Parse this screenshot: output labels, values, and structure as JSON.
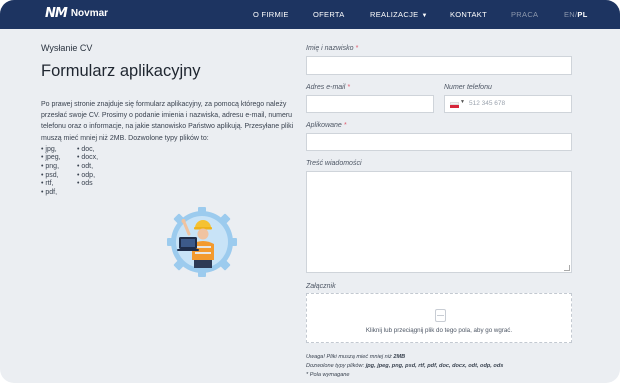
{
  "header": {
    "logo_mark": "NM",
    "logo_text": "Novmar",
    "nav": [
      {
        "label": "O FIRMIE"
      },
      {
        "label": "OFERTA"
      },
      {
        "label": "REALIZACJE"
      },
      {
        "label": "KONTAKT"
      },
      {
        "label": "PRACA"
      }
    ],
    "lang_en": "EN/",
    "lang_pl": "PL"
  },
  "intro": {
    "subtitle": "Wysłanie CV",
    "title": "Formularz aplikacyjny",
    "description": "Po prawej stronie znajduje się formularz aplikacyjny, za pomocą którego należy przesłać swoje CV. Prosimy o podanie imienia i nazwiska, adresu e-mail, numeru telefonu oraz o informacje, na jakie stanowisko Państwo aplikują. Przesyłane pliki muszą mieć mniej niż 2MB. Dozwolone typy plików to:",
    "file_types": [
      "• jpg,",
      "• doc,",
      "• jpeg,",
      "• docx,",
      "• png,",
      "• odt,",
      "• psd,",
      "• odp,",
      "• rtf,",
      "• ods",
      "• pdf,",
      ""
    ]
  },
  "form": {
    "name_label": "Imię i nazwisko",
    "email_label": "Adres e-mail",
    "phone_label": "Numer telefonu",
    "phone_placeholder": "512 345 678",
    "applying_label": "Aplikowane",
    "message_label": "Treść wiadomości",
    "attachment_label": "Załącznik",
    "dropzone_text": "Kliknij lub przeciągnij plik do tego pola, aby go wgrać.",
    "required_mark": "*",
    "accent_color": "#e0596b"
  },
  "notes": {
    "line1_prefix": "Uwaga! Pliki muszą mieć mniej niż ",
    "line1_value": "2MB",
    "line2_prefix": "Dozwolone typy plików: ",
    "line2_value": "jpg, jpeg, png, psd, rtf, pdf, doc, docx, odt, odp, ods",
    "line3": "* Pola wymagane"
  }
}
